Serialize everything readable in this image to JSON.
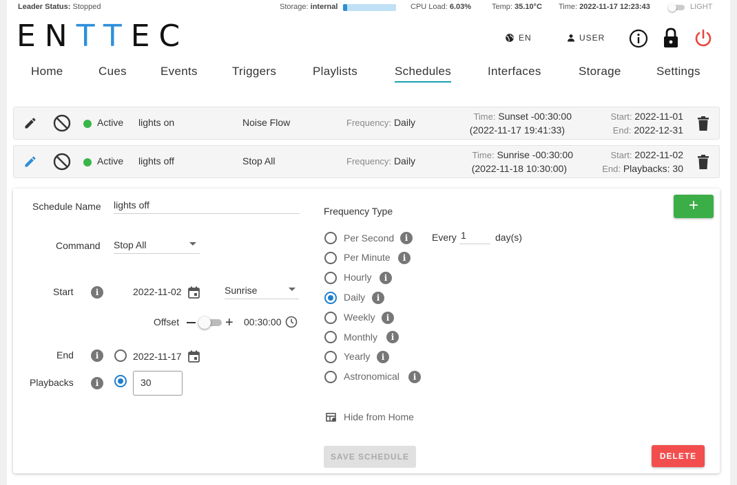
{
  "status": {
    "leader_label": "Leader Status:",
    "leader_value": "Stopped",
    "storage_label": "Storage:",
    "storage_value": "internal",
    "storage_used_fraction": 0.08,
    "cpu_label": "CPU Load:",
    "cpu_value": "6.03%",
    "temp_label": "Temp:",
    "temp_value": "35.10°C",
    "time_label": "Time:",
    "time_value": "2022-11-17 12:23:43",
    "theme_label": "LIGHT"
  },
  "header": {
    "logo_parts": [
      "EN",
      "TT",
      "EC"
    ],
    "language": "EN",
    "user": "USER",
    "icons": [
      "globe-icon",
      "person-icon",
      "info-icon",
      "lock-icon",
      "power-icon"
    ]
  },
  "nav": [
    "Home",
    "Cues",
    "Events",
    "Triggers",
    "Playlists",
    "Schedules",
    "Interfaces",
    "Storage",
    "Settings"
  ],
  "nav_active": "Schedules",
  "schedules": [
    {
      "status": "Active",
      "name": "lights on",
      "command": "Noise Flow",
      "freq_label": "Frequency:",
      "frequency": "Daily",
      "time_label": "Time:",
      "time": "Sunset -00:30:00",
      "time_resolved": "(2022-11-17 19:41:33)",
      "start_label": "Start:",
      "start": "2022-11-01",
      "end_label": "End:",
      "end": "2022-12-31"
    },
    {
      "status": "Active",
      "name": "lights off",
      "command": "Stop All",
      "freq_label": "Frequency:",
      "frequency": "Daily",
      "time_label": "Time:",
      "time": "Sunrise -00:30:00",
      "time_resolved": "(2022-11-18 10:30:00)",
      "start_label": "Start:",
      "start": "2022-11-02",
      "end_label": "End:",
      "end": "Playbacks: 30"
    }
  ],
  "form": {
    "name_label": "Schedule Name",
    "name_value": "lights off",
    "command_label": "Command",
    "command_value": "Stop All",
    "start_label": "Start",
    "start_date": "2022-11-02",
    "start_event": "Sunrise",
    "offset_label": "Offset",
    "offset_value": "00:30:00",
    "end_label": "End",
    "end_date": "2022-11-17",
    "playbacks_label": "Playbacks",
    "playbacks_value": "30",
    "freq_type_label": "Frequency Type",
    "freq_options": [
      "Per Second",
      "Per Minute",
      "Hourly",
      "Daily",
      "Weekly",
      "Monthly",
      "Yearly",
      "Astronomical"
    ],
    "freq_selected": "Daily",
    "every_label": "Every",
    "every_value": "1",
    "every_unit": "day(s)",
    "hide_label": "Hide from Home",
    "add_label": "+",
    "save_label": "SAVE SCHEDULE",
    "delete_label": "DELETE"
  },
  "colors": {
    "accent_blue": "#2e8fd8",
    "active_green": "#3ab54a",
    "add_green": "#3cae48",
    "delete_red": "#f24e4e",
    "power_red": "#e8453c",
    "tab_underline": "#1aa0b0"
  }
}
